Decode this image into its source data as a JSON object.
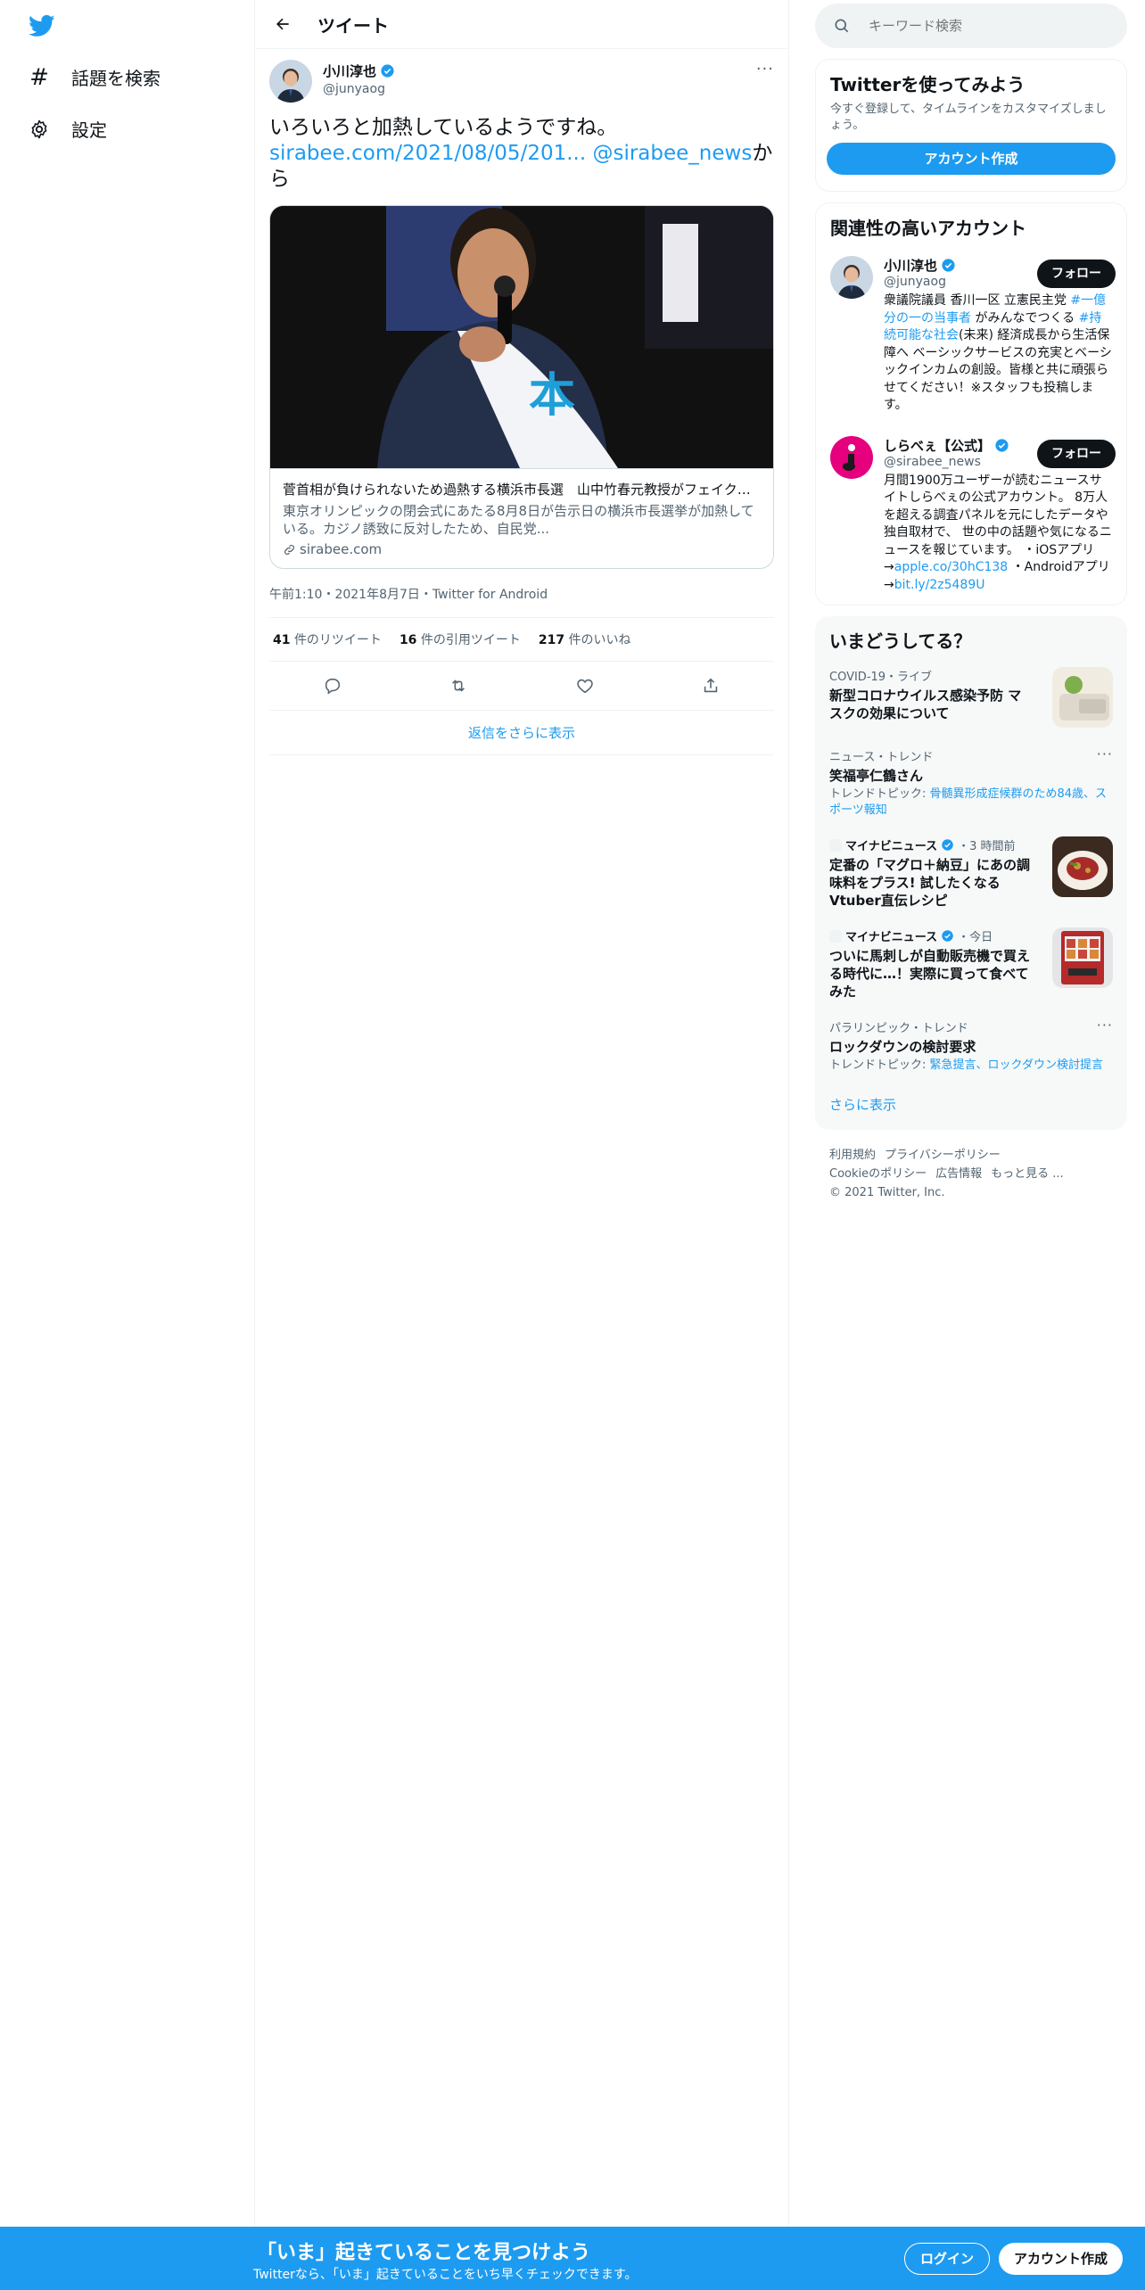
{
  "nav": {
    "explore_label": "話題を検索",
    "settings_label": "設定"
  },
  "header": {
    "title": "ツイート"
  },
  "tweet": {
    "author_name": "小川淳也",
    "author_handle": "@junyaog",
    "text": "いろいろと加熱しているようですね。",
    "link_text": "sirabee.com/2021/08/05/201...",
    "mention_text": "@sirabee_news",
    "suffix_text": "から",
    "card": {
      "title": "菅首相が負けられないため過熱する横浜市長選　山中竹春元教授がフェイクニ...",
      "description": "東京オリンピックの閉会式にあたる8月8日が告示日の横浜市長選挙が加熱している。カジノ誘致に反対したため、自民党...",
      "domain": "sirabee.com"
    },
    "meta": "午前1:10・2021年8月7日・Twitter for Android",
    "retweets_count": "41",
    "retweets_label": "件のリツイート",
    "quotes_count": "16",
    "quotes_label": "件の引用ツイート",
    "likes_count": "217",
    "likes_label": "件のいいね",
    "show_more_replies": "返信をさらに表示"
  },
  "search": {
    "placeholder": "キーワード検索"
  },
  "try_twitter": {
    "title": "Twitterを使ってみよう",
    "description": "今すぐ登録して、タイムラインをカスタマイズしましょう。",
    "button": "アカウント作成"
  },
  "related": {
    "title": "関連性の高いアカウント",
    "accounts": [
      {
        "name": "小川淳也",
        "handle": "@junyaog",
        "follow": "フォロー",
        "bio_parts": [
          "衆議院議員 香川一区 立憲民主党 ",
          "#一億分の一の当事者",
          " がみんなでつくる ",
          "#持続可能な社会",
          "(未来) 経済成長から生活保障へ ベーシックサービスの充実とベーシックインカムの創設。皆様と共に頑張らせてください！※スタッフも投稿します。"
        ]
      },
      {
        "name": "しらべぇ【公式】",
        "handle": "@sirabee_news",
        "follow": "フォロー",
        "bio_parts": [
          "月間1900万ユーザーが読むニュースサイトしらべぇの公式アカウント。 8万人を超える調査パネルを元にしたデータや独自取材で、 世の中の話題や気になるニュースを報じています。 ・iOSアプリ→",
          "apple.co/30hC138",
          " ・Androidアプリ→",
          "bit.ly/2z5489U"
        ]
      }
    ]
  },
  "trends": {
    "title": "いまどうしてる？",
    "items": [
      {
        "category": "COVID-19・ライブ",
        "title": "新型コロナウイルス感染予防 マスクの効果について"
      },
      {
        "category": "ニュース・トレンド",
        "title": "笑福亭仁鶴さん",
        "sub_prefix": "トレンドトピック: ",
        "sub_link": "骨髄異形成症候群のため84歳、スポーツ報知"
      },
      {
        "source": "マイナビニュース",
        "time": "・3 時間前",
        "title": "定番の「マグロ＋納豆」にあの調味料をプラス! 試したくなるVtuber直伝レシピ"
      },
      {
        "source": "マイナビニュース",
        "time": "・今日",
        "title": "ついに馬刺しが自動販売機で買える時代に…！実際に買って食べてみた"
      },
      {
        "category": "パラリンピック・トレンド",
        "title": "ロックダウンの検討要求",
        "sub_prefix": "トレンドトピック: ",
        "sub_link": "緊急提言、ロックダウン検討提言"
      }
    ],
    "show_more": "さらに表示"
  },
  "footer": {
    "links": [
      "利用規約",
      "プライバシーポリシー",
      "Cookieのポリシー",
      "広告情報",
      "もっと見る ..."
    ],
    "copyright": "© 2021 Twitter, Inc."
  },
  "bottom_bar": {
    "title": "「いま」起きていることを見つけよう",
    "subtitle": "Twitterなら、「いま」起きていることをいち早くチェックできます。",
    "login": "ログイン",
    "signup": "アカウント作成"
  },
  "colors": {
    "accent": "#1d9bf0",
    "text": "#0f1419",
    "secondary": "#536471",
    "border": "#eff3f4"
  }
}
